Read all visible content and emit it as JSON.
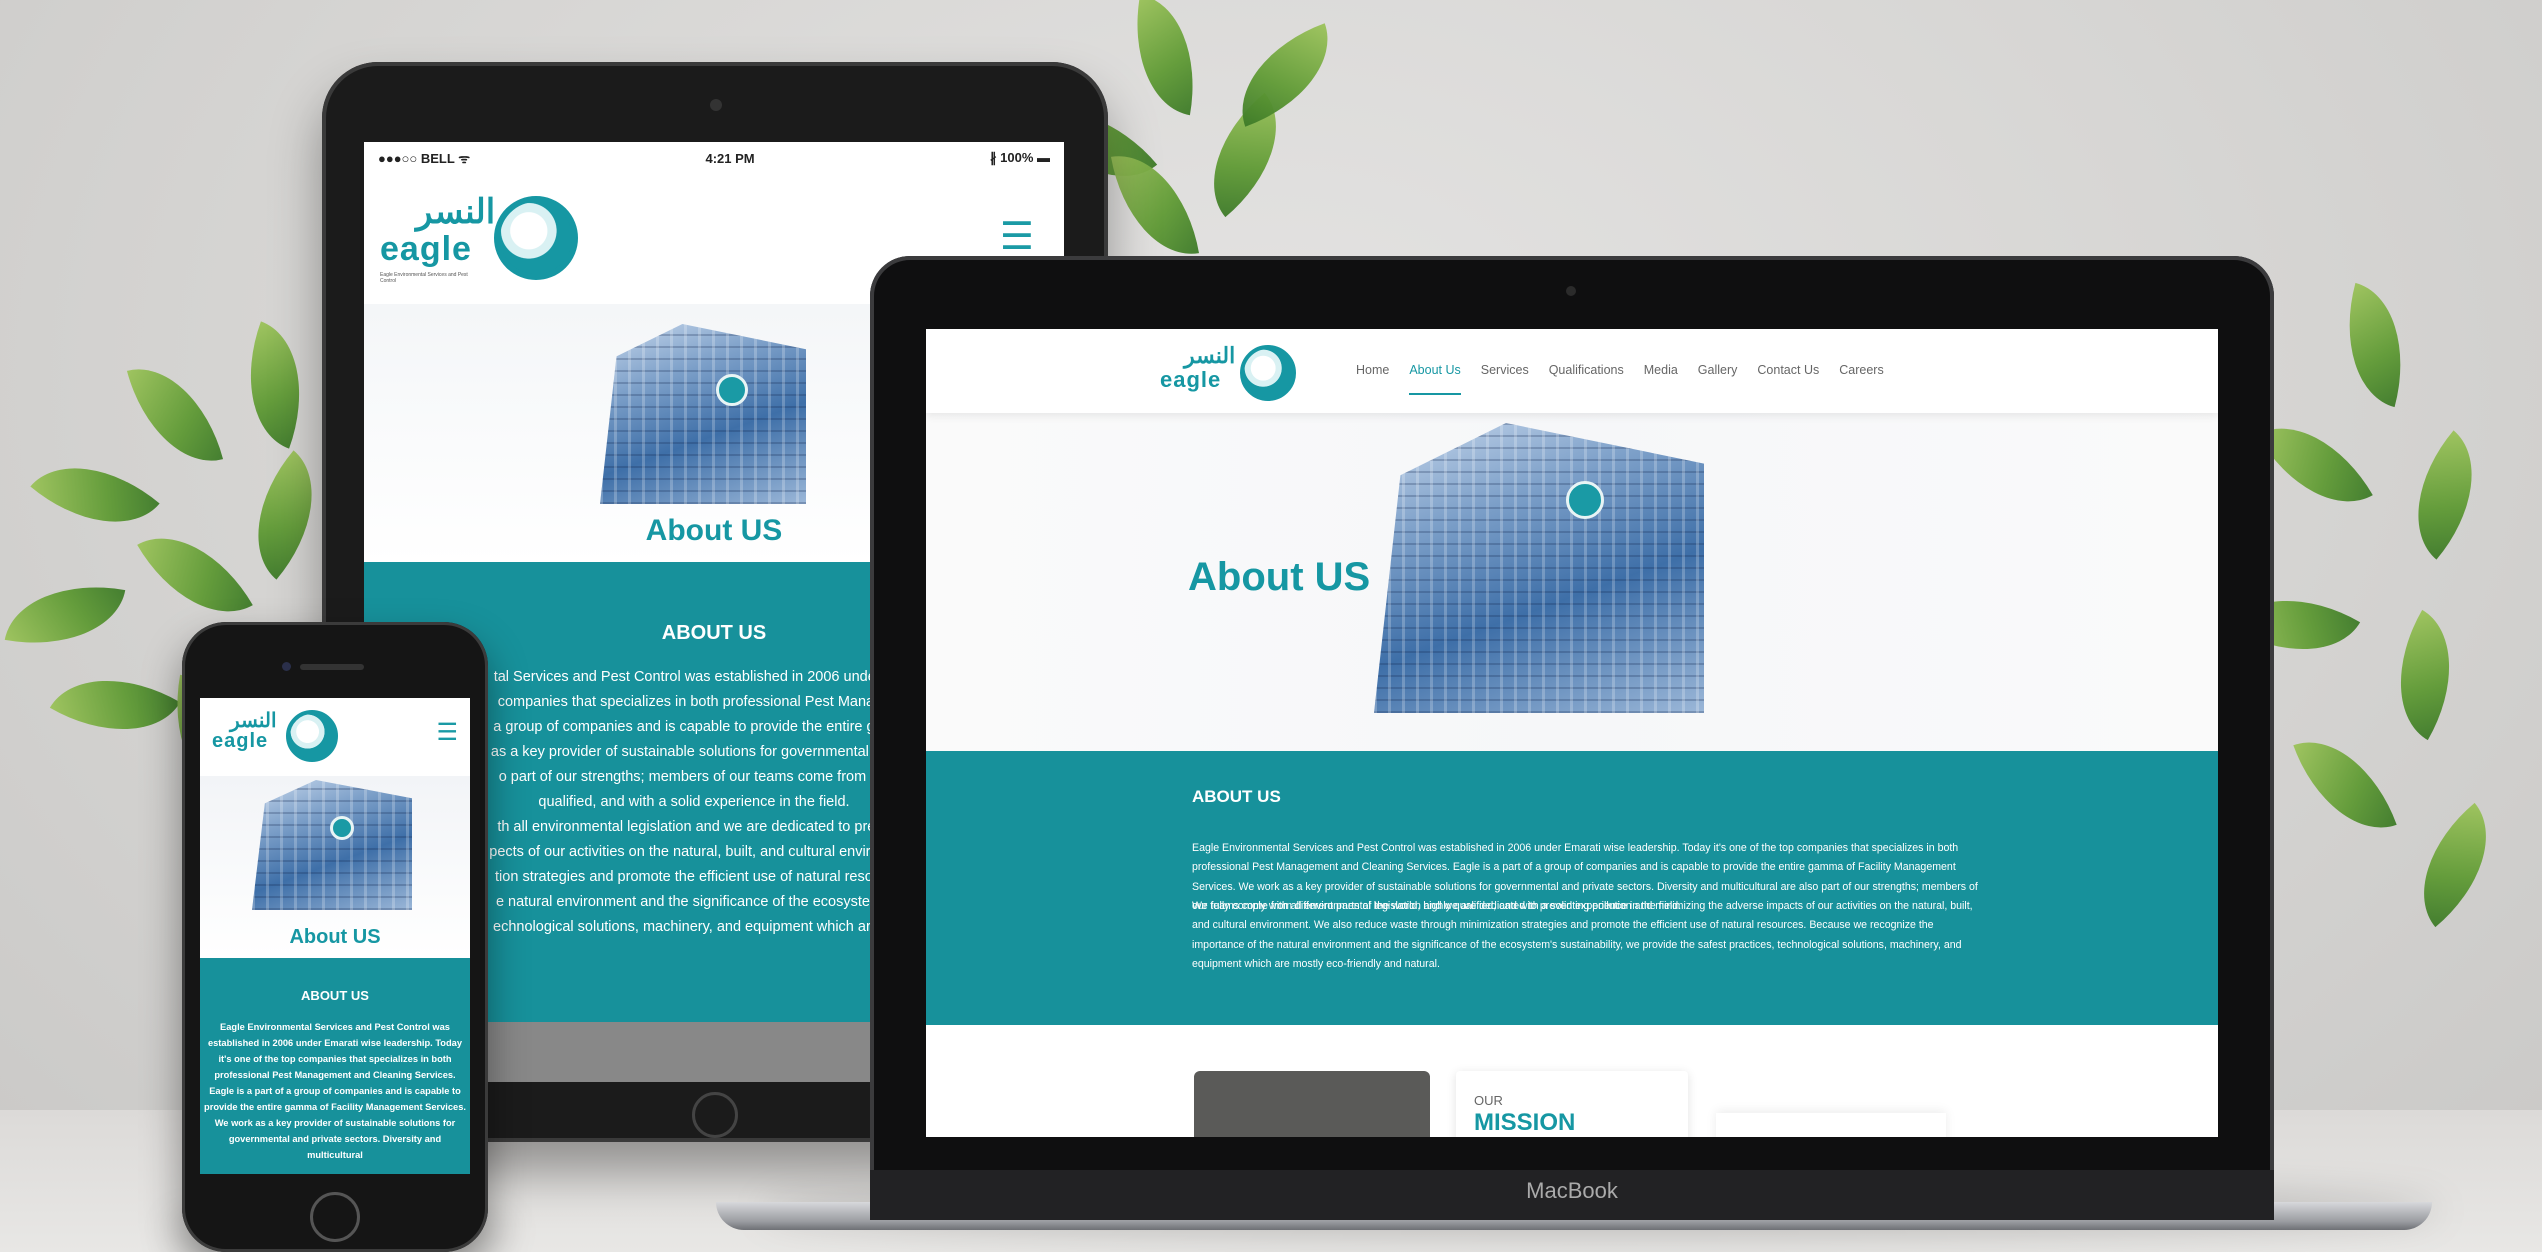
{
  "scene": {
    "description_colors": {
      "accent": "#1697a3",
      "band": "#17919b",
      "background": "#d6d5d3"
    }
  },
  "brand": {
    "arabic": "النسر",
    "latin": "eagle",
    "tagline": "Eagle Environmental Services and Pest Control"
  },
  "tablet": {
    "status": {
      "carrier": "●●●○○ BELL ᯤ",
      "time": "4:21 PM",
      "battery": "∦ 100% ▬"
    },
    "hero_title": "About US",
    "section_heading": "ABOUT US",
    "lines": [
      "tal Services and Pest Control was established in 2006 under E",
      "companies that specializes in both professional Pest Manage",
      "a group of companies and is capable to provide the entire gam",
      "as a key provider of sustainable solutions for governmental and",
      "o part of our strengths; members of our teams come from diff",
      "qualified, and with a solid experience in the field.",
      "th all environmental legislation and we are dedicated to preve",
      "pects of our activities on the natural, built, and cultural environm",
      "tion strategies and promote the efficient use of natural resourc",
      "e natural environment and the significance of the ecosystem's",
      "echnological solutions, machinery, and equipment which are m"
    ]
  },
  "phone": {
    "hero_title": "About US",
    "section_heading": "ABOUT US",
    "body": "Eagle Environmental Services and Pest Control was established in 2006 under Emarati wise leadership. Today it's one of the top companies that specializes in both professional Pest Management and Cleaning Services. Eagle is a part of a group of companies and is capable to provide the entire gamma of Facility Management Services. We work as a key provider of sustainable solutions for governmental and private sectors. Diversity and multicultural"
  },
  "macbook": {
    "label": "MacBook",
    "nav": [
      "Home",
      "About Us",
      "Services",
      "Qualifications",
      "Media",
      "Gallery",
      "Contact Us",
      "Careers"
    ],
    "active_nav": "About Us",
    "hero_title": "About US",
    "section_heading": "ABOUT US",
    "paragraph_1": "Eagle Environmental Services and Pest Control was established in 2006 under Emarati wise leadership. Today it's one of the top companies that specializes in both professional Pest Management and Cleaning Services. Eagle is a part of a group of companies and is capable to provide the entire gamma of Facility Management Services. We work as a key provider of sustainable solutions for governmental and private sectors. Diversity and multicultural are also part of our strengths; members of our teams come from different parts of the world, highly qualified, and with a solid experience in the field.",
    "paragraph_2": "We fully comply with all environmental legislation and we are dedicated to preventing pollution and minimizing the adverse impacts of our activities on the natural, built, and cultural environment. We also reduce waste through minimization strategies and promote the efficient use of natural resources. Because we recognize the importance of the natural environment and the significance of the ecosystem's sustainability, we provide the safest practices, technological solutions, machinery, and equipment which are mostly eco-friendly and natural.",
    "mission_our": "OUR",
    "mission_title": "MISSION"
  }
}
